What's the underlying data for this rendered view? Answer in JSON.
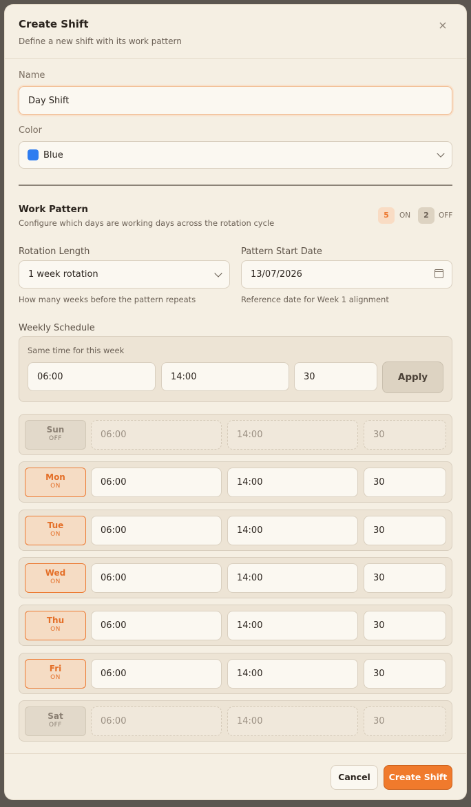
{
  "dialog": {
    "title": "Create Shift",
    "subtitle": "Define a new shift with its work pattern",
    "close_glyph": "×"
  },
  "name_field": {
    "label": "Name",
    "value": "Day Shift"
  },
  "color_field": {
    "label": "Color",
    "value": "Blue",
    "swatch": "#2f7df0"
  },
  "work_pattern": {
    "title": "Work Pattern",
    "description": "Configure which days are working days across the rotation cycle",
    "on_count": "5",
    "on_label": "ON",
    "off_count": "2",
    "off_label": "OFF"
  },
  "rotation": {
    "label": "Rotation Length",
    "value": "1 week rotation",
    "hint": "How many weeks before the pattern repeats"
  },
  "start_date": {
    "label": "Pattern Start Date",
    "value": "13/07/2026",
    "hint": "Reference date for Week 1 alignment"
  },
  "weekly_schedule": {
    "label": "Weekly Schedule",
    "same_time_label": "Same time for this week",
    "start": "06:00",
    "end": "14:00",
    "break": "30",
    "apply_label": "Apply"
  },
  "days": [
    {
      "name": "Sun",
      "state": "OFF",
      "start": "06:00",
      "end": "14:00",
      "break": "30"
    },
    {
      "name": "Mon",
      "state": "ON",
      "start": "06:00",
      "end": "14:00",
      "break": "30"
    },
    {
      "name": "Tue",
      "state": "ON",
      "start": "06:00",
      "end": "14:00",
      "break": "30"
    },
    {
      "name": "Wed",
      "state": "ON",
      "start": "06:00",
      "end": "14:00",
      "break": "30"
    },
    {
      "name": "Thu",
      "state": "ON",
      "start": "06:00",
      "end": "14:00",
      "break": "30"
    },
    {
      "name": "Fri",
      "state": "ON",
      "start": "06:00",
      "end": "14:00",
      "break": "30"
    },
    {
      "name": "Sat",
      "state": "OFF",
      "start": "06:00",
      "end": "14:00",
      "break": "30"
    }
  ],
  "footer": {
    "cancel_label": "Cancel",
    "create_label": "Create Shift"
  },
  "colors": {
    "accent": "#f07a2c",
    "background": "#f5efe3"
  }
}
